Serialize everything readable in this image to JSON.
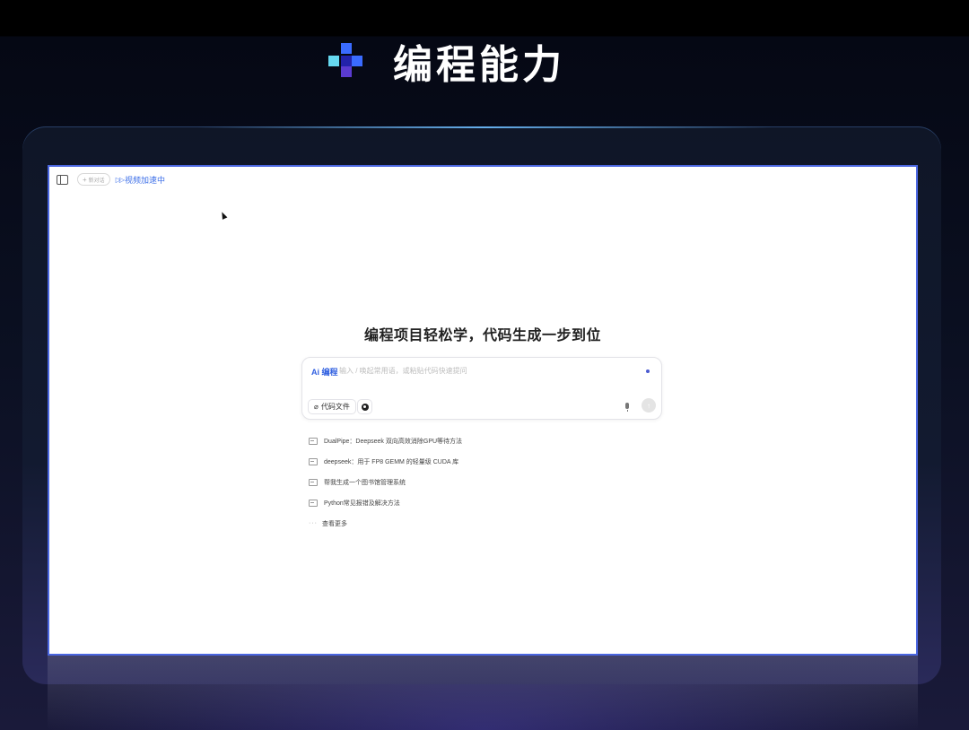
{
  "heading": {
    "title": "编程能力",
    "logo_colors": [
      "#66d9f0",
      "#3a6bff",
      "#2222aa",
      "#5a3bd0"
    ]
  },
  "toolbar": {
    "new_chat_label": "新对话",
    "accel_label": "视频加速中"
  },
  "main": {
    "title": "编程项目轻松学，代码生成一步到位",
    "input": {
      "tag": "Ai 编程",
      "placeholder": "输入 / 唤起常用语，或粘贴代码快速提问",
      "attach_label": "代码文件"
    },
    "suggestions": [
      "DualPipe：Deepseek 双向高效消除GPU等待方法",
      "deepseek：用于 FP8 GEMM 的轻量级 CUDA 库",
      "帮我生成一个图书馆管理系统",
      "Python常见报错及解决方法"
    ],
    "more_label": "查看更多"
  },
  "colors": {
    "accent": "#3b6ee8",
    "frame_border": "#4a66e0"
  }
}
